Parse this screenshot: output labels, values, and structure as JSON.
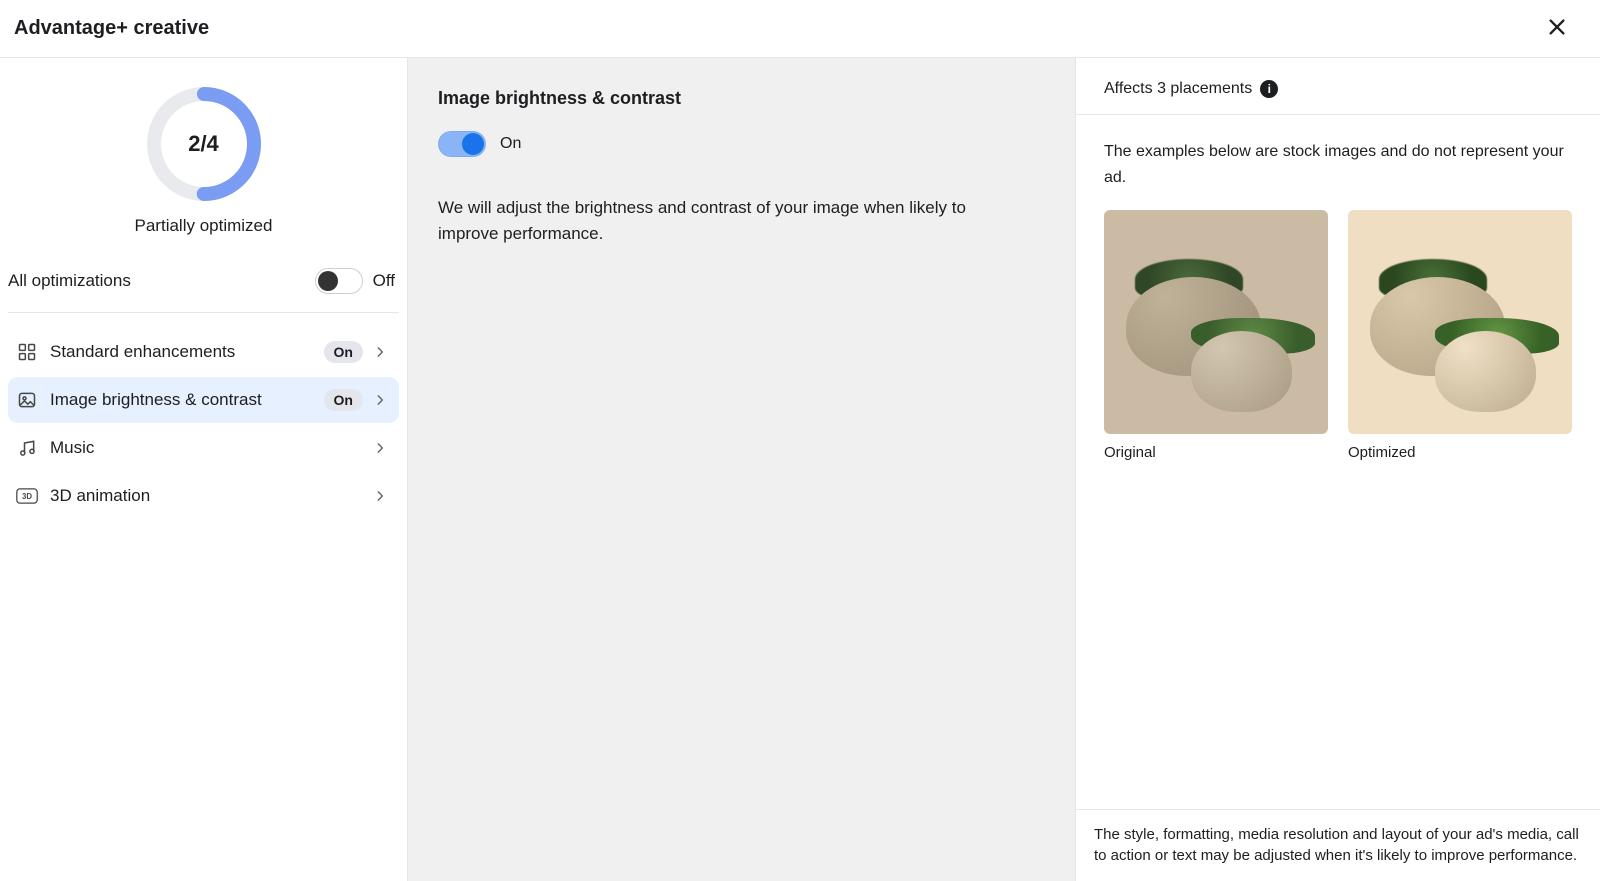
{
  "header": {
    "title": "Advantage+ creative"
  },
  "progress": {
    "fraction": "2/4",
    "label": "Partially optimized",
    "percent": 50
  },
  "all_optimizations": {
    "label": "All optimizations",
    "state_label": "Off"
  },
  "options": [
    {
      "id": "standard",
      "label": "Standard enhancements",
      "state_pill": "On",
      "active": false
    },
    {
      "id": "brightness",
      "label": "Image brightness & contrast",
      "state_pill": "On",
      "active": true
    },
    {
      "id": "music",
      "label": "Music",
      "state_pill": null,
      "active": false
    },
    {
      "id": "3d",
      "label": "3D animation",
      "state_pill": null,
      "active": false
    }
  ],
  "main": {
    "title": "Image brightness & contrast",
    "toggle_state_label": "On",
    "description": "We will adjust the brightness and contrast of your image when likely to improve performance."
  },
  "right": {
    "affects_label": "Affects 3 placements",
    "disclaimer": "The examples below are stock images and do not represent your ad.",
    "example_original": "Original",
    "example_optimized": "Optimized",
    "footer": "The style, formatting, media resolution and layout of your ad's media, call to action or text may be adjusted when it's likely to improve performance."
  }
}
